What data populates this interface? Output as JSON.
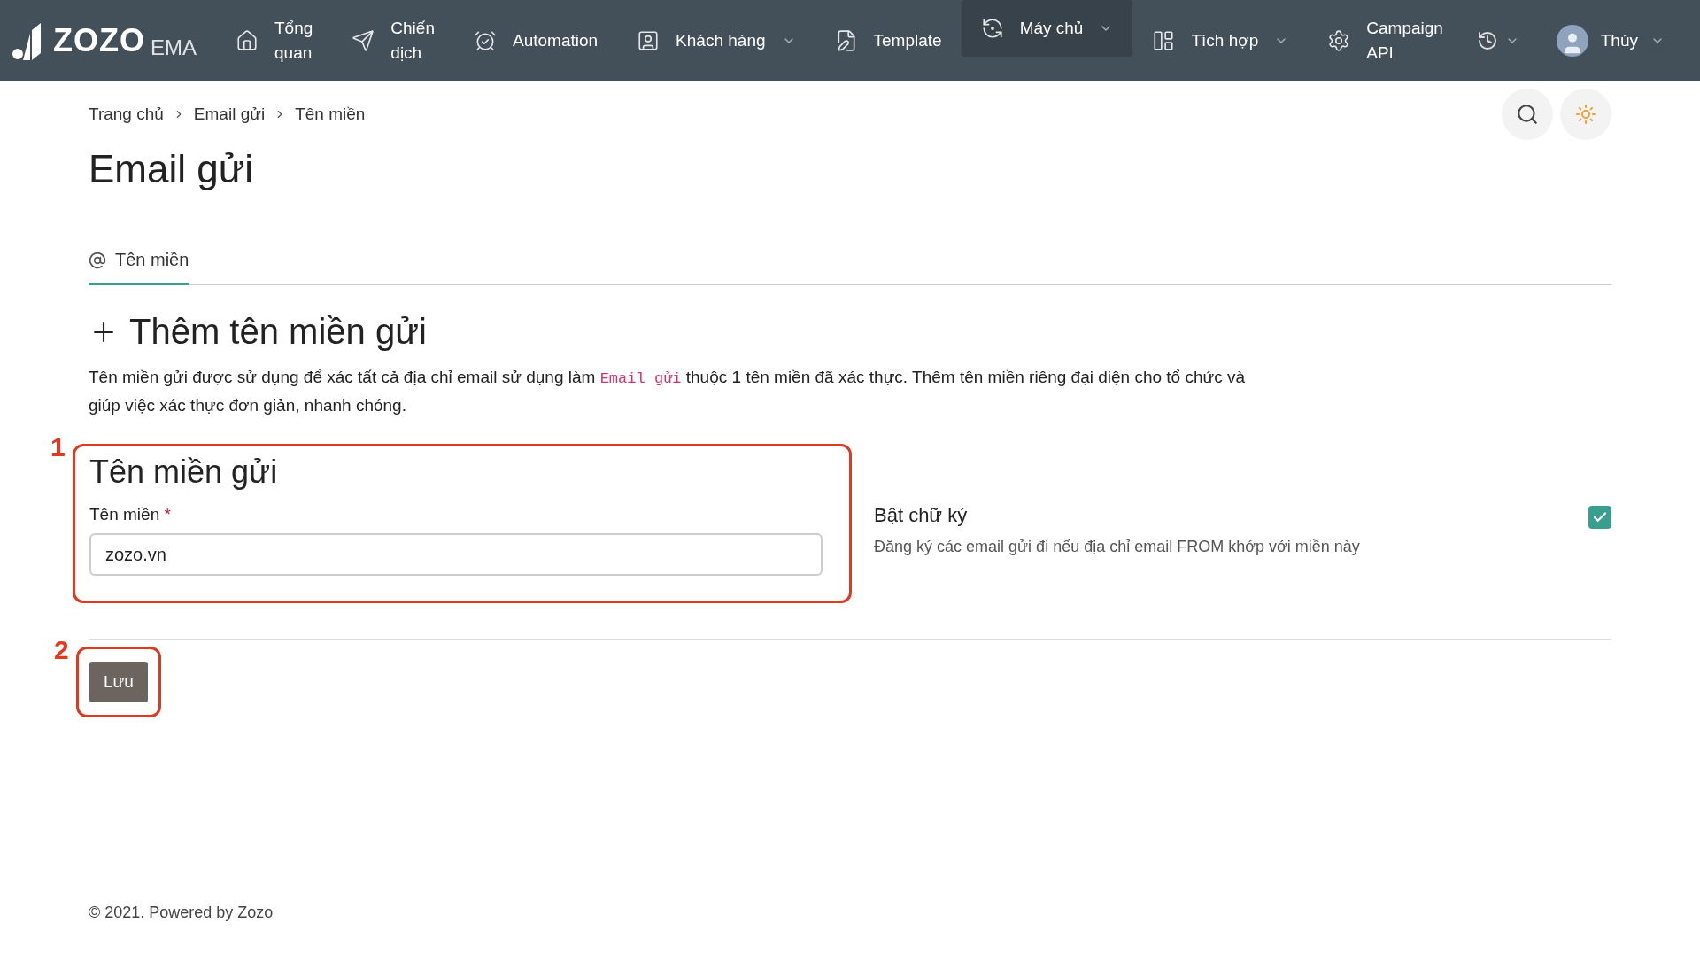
{
  "nav": {
    "logo": {
      "brand": "ZOZO",
      "suffix": "EMA"
    },
    "items": [
      {
        "lines": [
          "Tổng",
          "quan"
        ],
        "dropdown": false,
        "selected": false
      },
      {
        "lines": [
          "Chiến",
          "dịch"
        ],
        "dropdown": false,
        "selected": false
      },
      {
        "lines": [
          "Automation"
        ],
        "dropdown": false,
        "selected": false
      },
      {
        "lines": [
          "Khách hàng"
        ],
        "dropdown": true,
        "selected": false
      },
      {
        "lines": [
          "Template"
        ],
        "dropdown": false,
        "selected": false
      },
      {
        "lines": [
          "Máy chủ"
        ],
        "dropdown": true,
        "selected": true
      },
      {
        "lines": [
          "Tích hợp"
        ],
        "dropdown": true,
        "selected": false
      },
      {
        "lines": [
          "Campaign",
          "API"
        ],
        "dropdown": false,
        "selected": false
      }
    ],
    "user": {
      "name": "Thúy"
    }
  },
  "breadcrumb": [
    "Trang chủ",
    "Email gửi",
    "Tên miền"
  ],
  "page_title": "Email gửi",
  "tabs": [
    {
      "label": "Tên miền",
      "selected": true
    }
  ],
  "section": {
    "title": "Thêm tên miền gửi",
    "description": [
      {
        "kind": "text",
        "text": "Tên miền gửi được sử dụng để xác tất cả địa chỉ email sử dụng làm "
      },
      {
        "kind": "code",
        "text": "Email gửi"
      },
      {
        "kind": "text",
        "text": " thuộc 1 tên miền đã xác thực. Thêm tên miền riêng đại diện cho tổ chức và giúp việc xác thực đơn giản, nhanh chóng."
      }
    ]
  },
  "form": {
    "annotation": "1",
    "title": "Tên miền gửi",
    "field_label": "Tên miền",
    "required_mark": "*",
    "value": "zozo.vn"
  },
  "signature": {
    "label": "Bật chữ ký",
    "hint": "Đăng ký các email gửi đi nếu địa chỉ email FROM khớp với miền này",
    "checked": true
  },
  "save": {
    "annotation": "2",
    "label": "Lưu"
  },
  "footer": "© 2021. Powered by Zozo"
}
